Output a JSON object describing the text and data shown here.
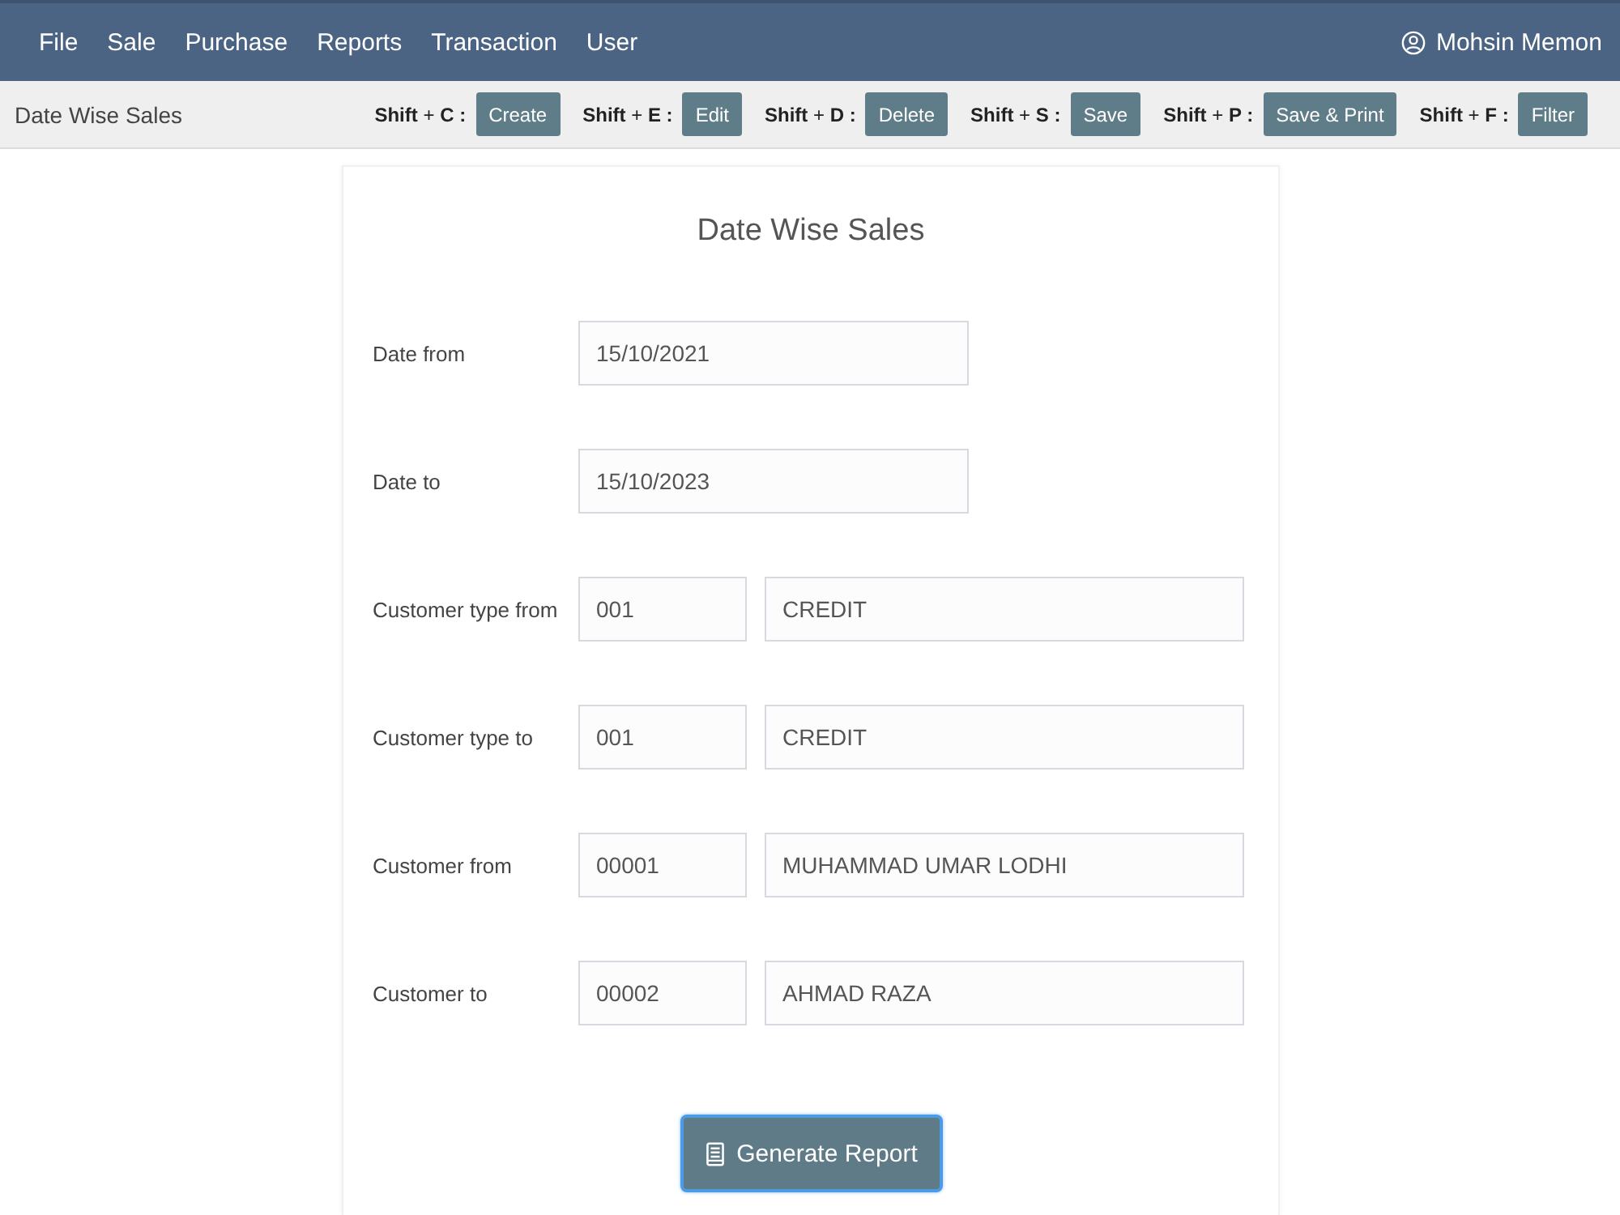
{
  "menu_bar": {
    "items": [
      "File",
      "Sale",
      "Purchase",
      "Reports",
      "Transaction",
      "User"
    ],
    "user": "Mohsin Memon"
  },
  "toolbar": {
    "title": "Date Wise Sales",
    "shortcuts": [
      {
        "keys": "**Shift** + **C :**",
        "button": "Create"
      },
      {
        "keys": "**Shift** + **E :**",
        "button": "Edit"
      },
      {
        "keys": "**Shift** + **D :**",
        "button": "Delete"
      },
      {
        "keys": "**Shift** + **S :**",
        "button": "Save"
      },
      {
        "keys": "**Shift** + **P :**",
        "button": "Save & Print"
      },
      {
        "keys": "**Shift** + **F :**",
        "button": "Filter"
      }
    ]
  },
  "form": {
    "title": "Date Wise Sales",
    "rows": [
      {
        "label": "Date from",
        "kind": "date",
        "value": "15/10/2021"
      },
      {
        "label": "Date to",
        "kind": "date",
        "value": "15/10/2023"
      },
      {
        "label": "Customer type from",
        "kind": "code_name",
        "code": "001",
        "name": "CREDIT"
      },
      {
        "label": "Customer type to",
        "kind": "code_name",
        "code": "001",
        "name": "CREDIT"
      },
      {
        "label": "Customer from",
        "kind": "code_name",
        "code": "00001",
        "name": "MUHAMMAD UMAR LODHI"
      },
      {
        "label": "Customer to",
        "kind": "code_name",
        "code": "00002",
        "name": "AHMAD RAZA"
      }
    ],
    "submit": {
      "label": "Generate Report",
      "focused": true
    }
  }
}
